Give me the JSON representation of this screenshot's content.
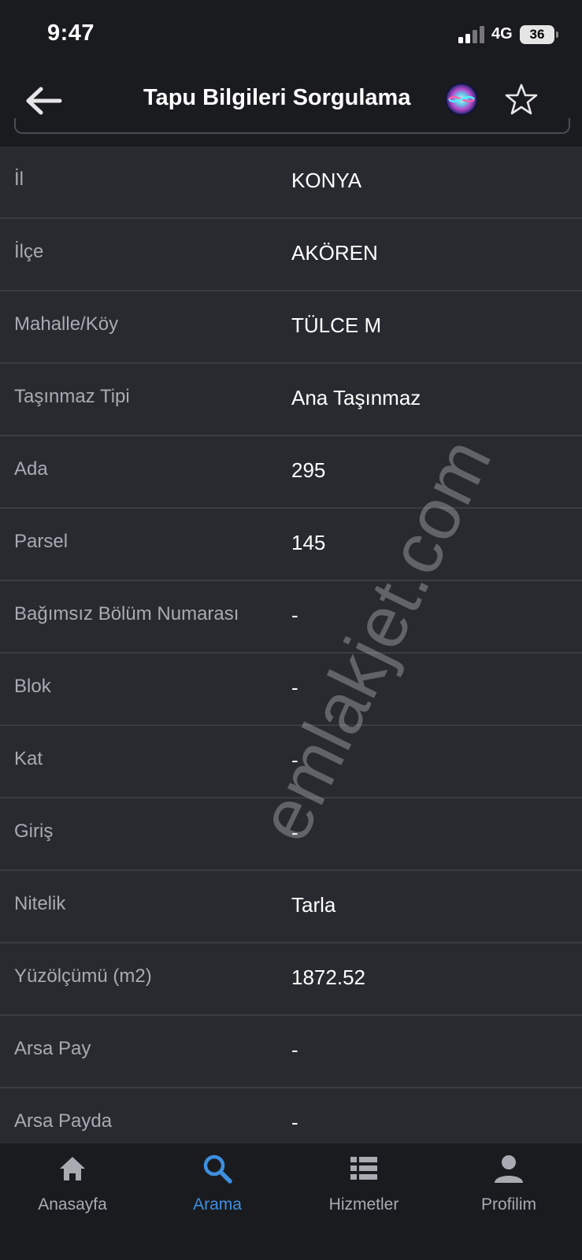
{
  "status_bar": {
    "time": "9:47",
    "network": "4G",
    "battery": "36"
  },
  "header": {
    "title": "Tapu Bilgileri Sorgulama",
    "icons": [
      "back-arrow-icon",
      "siri-icon",
      "star-icon"
    ]
  },
  "rows": [
    {
      "label": "İl",
      "value": "KONYA"
    },
    {
      "label": "İlçe",
      "value": "AKÖREN"
    },
    {
      "label": "Mahalle/Köy",
      "value": "TÜLCE M"
    },
    {
      "label": "Taşınmaz Tipi",
      "value": "Ana Taşınmaz"
    },
    {
      "label": "Ada",
      "value": "295"
    },
    {
      "label": "Parsel",
      "value": "145"
    },
    {
      "label": "Bağımsız Bölüm Numarası",
      "value": "-"
    },
    {
      "label": "Blok",
      "value": "-"
    },
    {
      "label": "Kat",
      "value": "-"
    },
    {
      "label": "Giriş",
      "value": "-"
    },
    {
      "label": "Nitelik",
      "value": "Tarla"
    },
    {
      "label": "Yüzölçümü (m2)",
      "value": "1872.52"
    },
    {
      "label": "Arsa Pay",
      "value": "-"
    },
    {
      "label": "Arsa Payda",
      "value": "-"
    }
  ],
  "watermark": "emlakjet.com",
  "tabs": [
    {
      "label": "Anasayfa",
      "icon": "home-icon",
      "active": false
    },
    {
      "label": "Arama",
      "icon": "search-icon",
      "active": true
    },
    {
      "label": "Hizmetler",
      "icon": "list-icon",
      "active": false
    },
    {
      "label": "Profilim",
      "icon": "user-icon",
      "active": false
    }
  ],
  "colors": {
    "background": "#1a1b1f",
    "row_background": "#282a30",
    "active_tab": "#3d8fe0",
    "label": "#a8abb1"
  }
}
